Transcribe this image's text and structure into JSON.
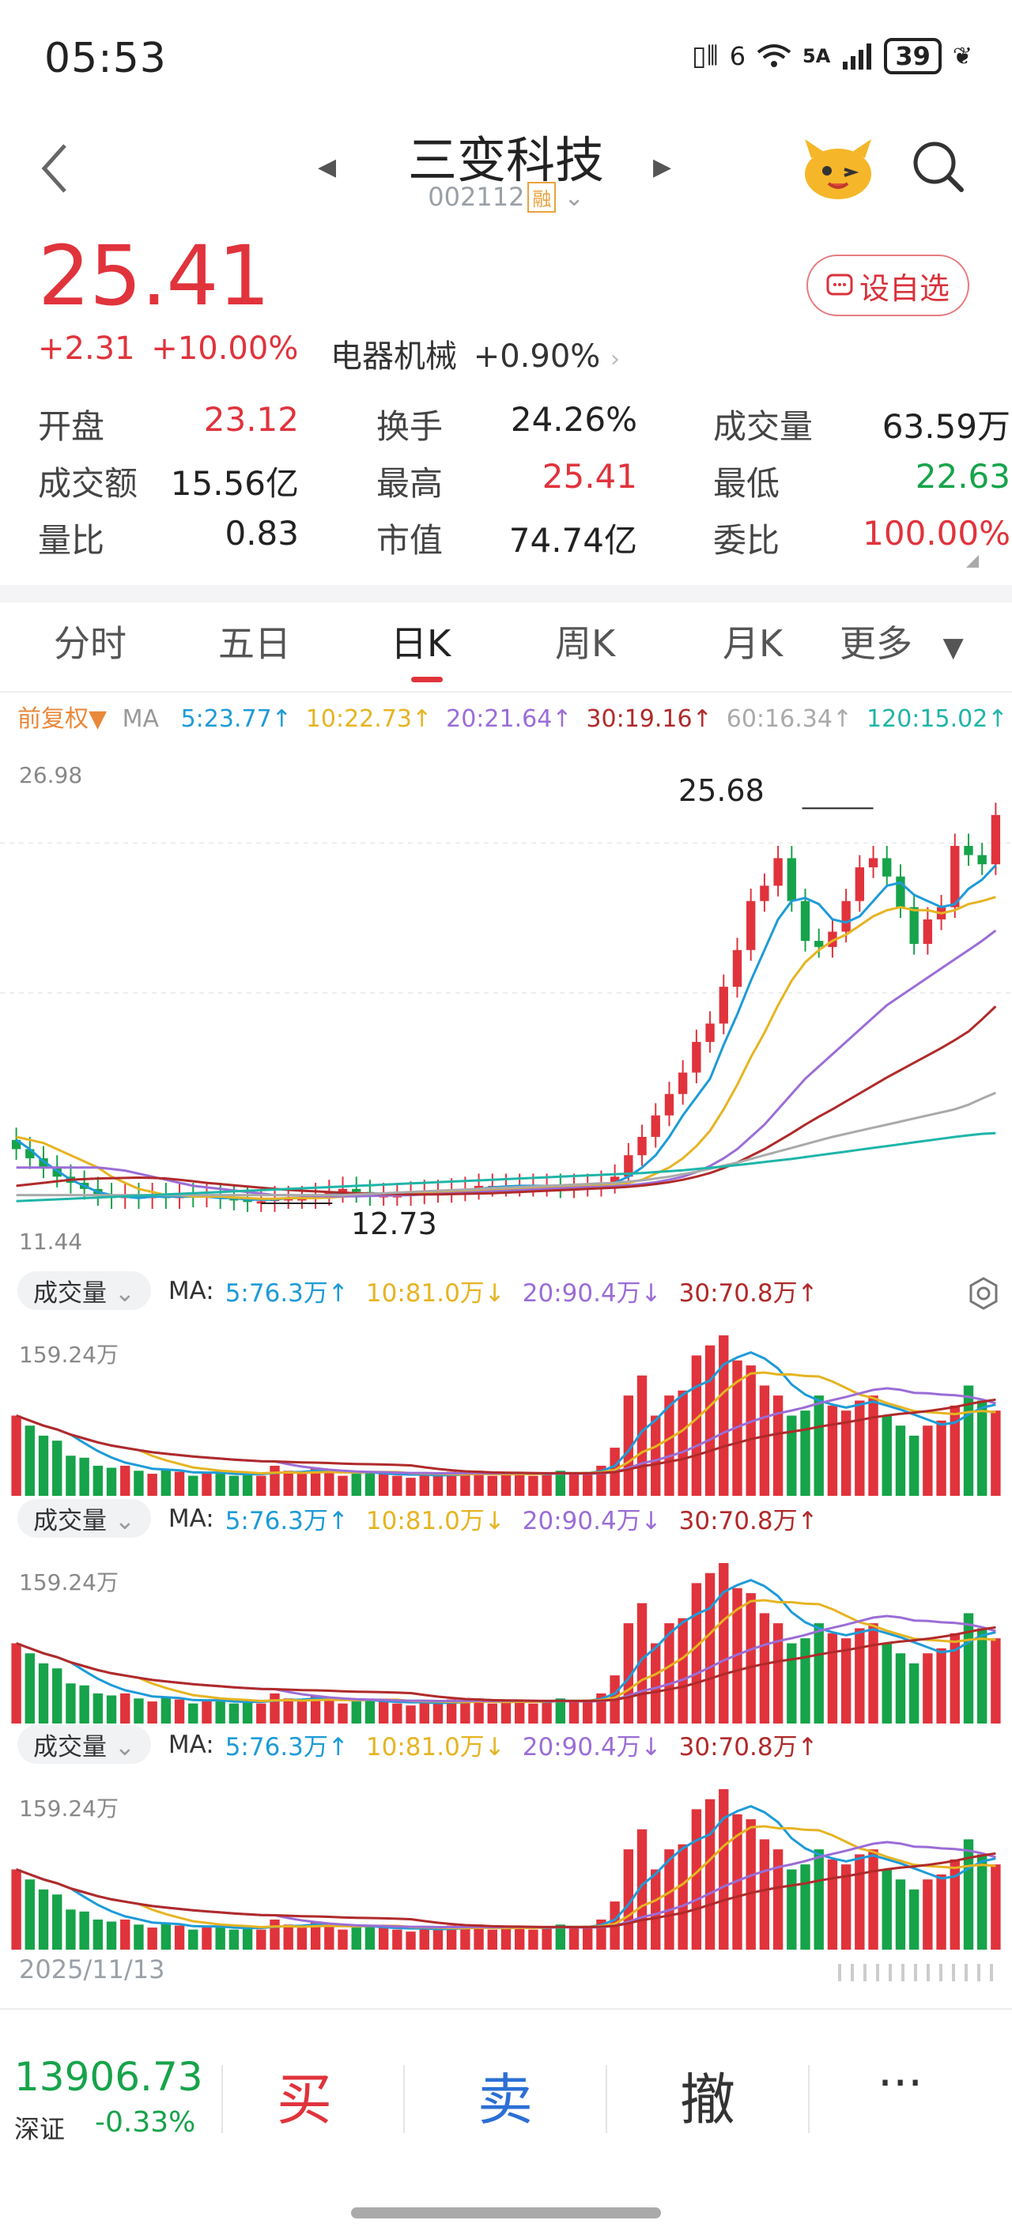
{
  "status_bar": {
    "time": "05:53",
    "network": "5A",
    "signal_prefix": "6",
    "battery": "39"
  },
  "header": {
    "stock_name": "三变科技",
    "stock_code": "002112",
    "margin_badge": "融"
  },
  "quote": {
    "price": "25.41",
    "change": "+2.31",
    "change_pct": "+10.00%",
    "sector_name": "电器机械",
    "sector_change": "+0.90%",
    "watchlist_label": "设自选"
  },
  "stats": {
    "open": {
      "label": "开盘",
      "value": "23.12"
    },
    "turnover_rate": {
      "label": "换手",
      "value": "24.26%"
    },
    "volume": {
      "label": "成交量",
      "value": "63.59万"
    },
    "amount": {
      "label": "成交额",
      "value": "15.56亿"
    },
    "high": {
      "label": "最高",
      "value": "25.41"
    },
    "low": {
      "label": "最低",
      "value": "22.63"
    },
    "volume_ratio": {
      "label": "量比",
      "value": "0.83"
    },
    "market_cap": {
      "label": "市值",
      "value": "74.74亿"
    },
    "order_ratio": {
      "label": "委比",
      "value": "100.00%"
    }
  },
  "tabs": [
    "分时",
    "五日",
    "日K",
    "周K",
    "月K",
    "更多"
  ],
  "active_tab": 2,
  "ma_bar": {
    "adjust": "前复权▼",
    "ma_label": "MA",
    "items": [
      {
        "text": "5:23.77↑",
        "color": "#1e9bd7"
      },
      {
        "text": "10:22.73↑",
        "color": "#e6b422"
      },
      {
        "text": "20:21.64↑",
        "color": "#9b6dd6"
      },
      {
        "text": "30:19.16↑",
        "color": "#b02a2a"
      },
      {
        "text": "60:16.34↑",
        "color": "#aaaaaa"
      },
      {
        "text": "120:15.02↑",
        "color": "#1fb5a8"
      }
    ]
  },
  "kline": {
    "max_label": "26.98",
    "min_label": "11.44",
    "high_marker": "25.68",
    "low_marker": "12.73"
  },
  "volume_panels": [
    {
      "title": "成交量",
      "ma_label": "MA:",
      "max_label": "159.24万",
      "items": [
        {
          "text": "5:76.3万↑",
          "color": "#1e9bd7"
        },
        {
          "text": "10:81.0万↓",
          "color": "#e6b422"
        },
        {
          "text": "20:90.4万↓",
          "color": "#9b6dd6"
        },
        {
          "text": "30:70.8万↑",
          "color": "#b02a2a"
        }
      ]
    },
    {
      "title": "成交量",
      "ma_label": "MA:",
      "max_label": "159.24万",
      "items": [
        {
          "text": "5:76.3万↑",
          "color": "#1e9bd7"
        },
        {
          "text": "10:81.0万↓",
          "color": "#e6b422"
        },
        {
          "text": "20:90.4万↓",
          "color": "#9b6dd6"
        },
        {
          "text": "30:70.8万↑",
          "color": "#b02a2a"
        }
      ]
    },
    {
      "title": "成交量",
      "ma_label": "MA:",
      "max_label": "159.24万",
      "items": [
        {
          "text": "5:76.3万↑",
          "color": "#1e9bd7"
        },
        {
          "text": "10:81.0万↓",
          "color": "#e6b422"
        },
        {
          "text": "20:90.4万↓",
          "color": "#9b6dd6"
        },
        {
          "text": "30:70.8万↑",
          "color": "#b02a2a"
        }
      ]
    }
  ],
  "chart_date": "2025/11/13",
  "bottom_bar": {
    "index_value": "13906.73",
    "index_name": "深证",
    "index_change": "-0.33%",
    "buy": "买",
    "sell": "卖",
    "cancel": "撤",
    "more": "···"
  },
  "colors": {
    "up": "#e0333c",
    "down": "#16a34a"
  },
  "chart_data": {
    "type": "candlestick",
    "close": [
      14.5,
      14.2,
      13.9,
      13.6,
      13.4,
      13.2,
      13.0,
      12.9,
      13.0,
      12.9,
      13.0,
      12.9,
      13.0,
      12.95,
      13.0,
      12.9,
      12.85,
      12.8,
      12.8,
      12.9,
      12.9,
      12.9,
      13.0,
      13.1,
      13.2,
      13.1,
      13.0,
      13.0,
      13.0,
      13.05,
      13.1,
      13.1,
      13.15,
      13.2,
      13.3,
      13.3,
      13.3,
      13.3,
      13.3,
      13.3,
      13.25,
      13.3,
      13.3,
      13.4,
      13.6,
      14.3,
      14.9,
      15.6,
      16.3,
      17.0,
      18.0,
      18.6,
      19.8,
      21.0,
      22.6,
      23.1,
      24.0,
      22.6,
      21.3,
      21.1,
      21.6,
      22.6,
      23.7,
      24.0,
      23.4,
      22.4,
      21.2,
      22.0,
      22.4,
      24.4,
      24.1,
      23.8,
      25.41
    ],
    "volume": [
      80,
      70,
      60,
      55,
      40,
      38,
      30,
      28,
      30,
      25,
      22,
      26,
      24,
      20,
      24,
      22,
      20,
      22,
      20,
      30,
      25,
      22,
      28,
      24,
      20,
      22,
      24,
      22,
      20,
      18,
      22,
      20,
      24,
      22,
      25,
      20,
      22,
      24,
      20,
      22,
      25,
      22,
      24,
      30,
      48,
      100,
      120,
      80,
      100,
      105,
      140,
      150,
      160,
      135,
      130,
      110,
      100,
      80,
      85,
      100,
      90,
      85,
      95,
      100,
      80,
      70,
      60,
      70,
      75,
      90,
      110,
      95,
      85
    ],
    "ma5": [
      14.8,
      14.5,
      14.1,
      13.8,
      13.5,
      13.3,
      13.1,
      13.0,
      12.95,
      12.9,
      12.95,
      12.95,
      12.95,
      12.95,
      12.95,
      12.9,
      12.9,
      12.85,
      12.85,
      12.85,
      12.9,
      12.9,
      12.95,
      13.0,
      13.05,
      13.05,
      13.05,
      13.05,
      13.05,
      13.05,
      13.1,
      13.1,
      13.15,
      13.15,
      13.2,
      13.25,
      13.28,
      13.3,
      13.3,
      13.3,
      13.3,
      13.3,
      13.3,
      13.32,
      13.4,
      13.6,
      13.9,
      14.3,
      14.9,
      15.6,
      16.2,
      16.8,
      17.9,
      18.9,
      20.0,
      21.0,
      22.0,
      22.6,
      22.7,
      22.5,
      22.0,
      21.9,
      22.1,
      22.6,
      23.1,
      23.2,
      22.8,
      22.6,
      22.4,
      22.5,
      23.0,
      23.3,
      23.77
    ],
    "ma10": [
      14.9,
      14.8,
      14.7,
      14.5,
      14.3,
      14.1,
      13.9,
      13.6,
      13.4,
      13.2,
      13.1,
      13.0,
      13.0,
      12.95,
      12.95,
      12.95,
      12.92,
      12.9,
      12.88,
      12.88,
      12.9,
      12.9,
      12.9,
      12.92,
      12.95,
      12.98,
      13.0,
      13.02,
      13.05,
      13.05,
      13.07,
      13.08,
      13.1,
      13.12,
      13.15,
      13.18,
      13.2,
      13.22,
      13.24,
      13.25,
      13.26,
      13.28,
      13.29,
      13.3,
      13.33,
      13.4,
      13.5,
      13.7,
      13.9,
      14.2,
      14.6,
      15.1,
      15.8,
      16.6,
      17.5,
      18.3,
      19.2,
      20.0,
      20.6,
      21.0,
      21.3,
      21.5,
      21.8,
      22.1,
      22.3,
      22.4,
      22.3,
      22.3,
      22.2,
      22.3,
      22.5,
      22.6,
      22.73
    ],
    "ma20": [
      13.9,
      13.9,
      13.9,
      13.9,
      13.9,
      13.9,
      13.9,
      13.85,
      13.8,
      13.7,
      13.6,
      13.5,
      13.4,
      13.3,
      13.25,
      13.2,
      13.15,
      13.1,
      13.05,
      13.0,
      13.0,
      12.98,
      12.97,
      12.96,
      12.96,
      12.96,
      12.97,
      12.98,
      12.99,
      13.0,
      13.02,
      13.04,
      13.06,
      13.08,
      13.1,
      13.12,
      13.14,
      13.16,
      13.18,
      13.2,
      13.22,
      13.24,
      13.26,
      13.27,
      13.29,
      13.32,
      13.36,
      13.42,
      13.5,
      13.6,
      13.75,
      13.95,
      14.2,
      14.5,
      14.9,
      15.3,
      15.8,
      16.3,
      16.8,
      17.2,
      17.6,
      18.0,
      18.4,
      18.8,
      19.2,
      19.5,
      19.8,
      20.1,
      20.4,
      20.7,
      21.0,
      21.3,
      21.64
    ],
    "ma30": [
      13.3,
      13.35,
      13.4,
      13.45,
      13.5,
      13.52,
      13.54,
      13.55,
      13.56,
      13.57,
      13.56,
      13.54,
      13.5,
      13.45,
      13.4,
      13.36,
      13.32,
      13.28,
      13.24,
      13.2,
      13.17,
      13.14,
      13.12,
      13.1,
      13.08,
      13.06,
      13.05,
      13.04,
      13.03,
      13.02,
      13.02,
      13.02,
      13.03,
      13.04,
      13.05,
      13.06,
      13.08,
      13.1,
      13.12,
      13.14,
      13.16,
      13.18,
      13.2,
      13.22,
      13.24,
      13.27,
      13.31,
      13.36,
      13.42,
      13.5,
      13.6,
      13.72,
      13.88,
      14.06,
      14.28,
      14.5,
      14.76,
      15.02,
      15.3,
      15.56,
      15.8,
      16.06,
      16.32,
      16.58,
      16.84,
      17.08,
      17.32,
      17.56,
      17.8,
      18.06,
      18.34,
      18.74,
      19.16
    ],
    "ma60": [
      13.0,
      13.0,
      13.0,
      13.0,
      13.0,
      13.0,
      13.0,
      13.0,
      13.0,
      13.0,
      13.0,
      13.0,
      13.0,
      13.0,
      13.0,
      13.0,
      13.0,
      13.0,
      13.0,
      13.0,
      13.0,
      13.0,
      13.0,
      13.0,
      13.0,
      13.02,
      13.04,
      13.06,
      13.08,
      13.1,
      13.12,
      13.14,
      13.16,
      13.18,
      13.2,
      13.22,
      13.24,
      13.26,
      13.28,
      13.3,
      13.32,
      13.34,
      13.36,
      13.38,
      13.4,
      13.44,
      13.48,
      13.54,
      13.6,
      13.68,
      13.76,
      13.86,
      13.96,
      14.06,
      14.18,
      14.3,
      14.42,
      14.54,
      14.66,
      14.78,
      14.9,
      15.0,
      15.1,
      15.2,
      15.3,
      15.4,
      15.5,
      15.6,
      15.7,
      15.8,
      15.95,
      16.15,
      16.34
    ],
    "ma120": [
      12.8,
      12.82,
      12.84,
      12.86,
      12.88,
      12.9,
      12.92,
      12.94,
      12.96,
      12.98,
      13.0,
      13.02,
      13.04,
      13.06,
      13.08,
      13.1,
      13.12,
      13.14,
      13.16,
      13.18,
      13.2,
      13.22,
      13.24,
      13.26,
      13.28,
      13.3,
      13.32,
      13.34,
      13.36,
      13.38,
      13.4,
      13.42,
      13.44,
      13.46,
      13.48,
      13.5,
      13.52,
      13.54,
      13.56,
      13.58,
      13.6,
      13.62,
      13.64,
      13.66,
      13.68,
      13.7,
      13.72,
      13.75,
      13.78,
      13.81,
      13.85,
      13.89,
      13.93,
      13.98,
      14.03,
      14.08,
      14.13,
      14.18,
      14.24,
      14.3,
      14.36,
      14.42,
      14.48,
      14.54,
      14.6,
      14.66,
      14.72,
      14.78,
      14.84,
      14.9,
      14.95,
      15.0,
      15.02
    ],
    "ylim": [
      11.44,
      26.98
    ],
    "vol_max": 159.24
  }
}
